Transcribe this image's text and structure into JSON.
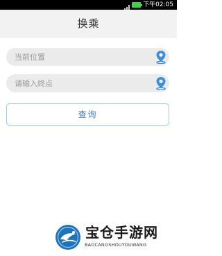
{
  "status_bar": {
    "time": "下午02:05",
    "icons": [
      "signal-icon",
      "battery-icon"
    ]
  },
  "header": {
    "title": "换乘"
  },
  "form": {
    "start_placeholder": "当前位置",
    "end_placeholder": "请输入终点",
    "start_value": "",
    "end_value": "",
    "pin_icon": "location-pin-icon",
    "query_label": "查询"
  },
  "watermark": {
    "title": "宝仓手游网",
    "subtitle": "BAOCANGSHOUYOUWANG"
  },
  "colors": {
    "status_bar_bg": "#000000",
    "battery": "#43d14a",
    "title_bar_bg": "#f2f2f2",
    "field_bg": "#ebebeb",
    "pin": "#3b8fd6",
    "button_border": "#9ec8e6",
    "button_text": "#3b7fc4",
    "logo": "#1e73be"
  }
}
